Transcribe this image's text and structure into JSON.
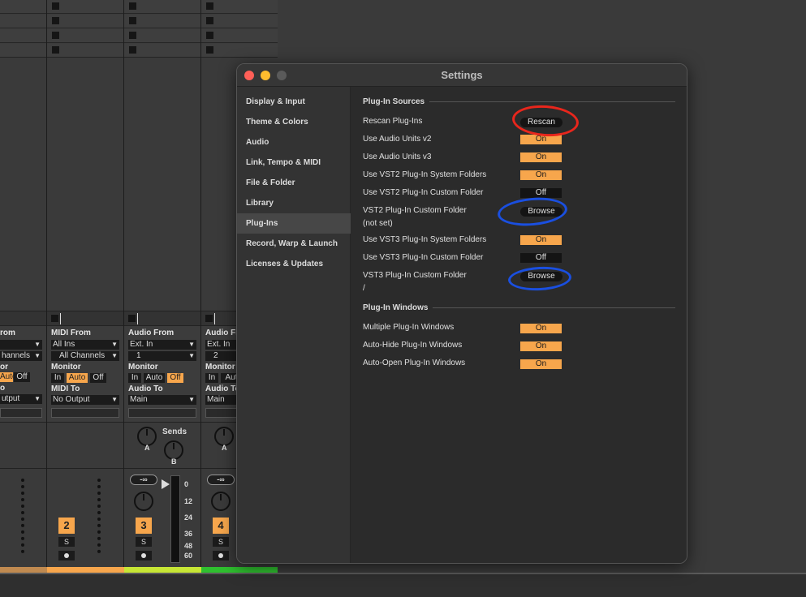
{
  "mixer": {
    "tracks": [
      {
        "from_label": "rom",
        "from_value": "",
        "ch_value": "hannels",
        "monitor_label": "or",
        "monitor_buttons": [
          "Auto",
          "Off"
        ],
        "to_label": "o",
        "to_value": "utput",
        "number": "",
        "solo": ""
      },
      {
        "from_label": "MIDI From",
        "from_value": "All Ins",
        "ch_value": "All Channels",
        "monitor_label": "Monitor",
        "monitor_buttons": [
          "In",
          "Auto",
          "Off"
        ],
        "to_label": "MIDI To",
        "to_value": "No Output",
        "number": "2",
        "solo": "S"
      },
      {
        "from_label": "Audio From",
        "from_value": "Ext. In",
        "ch_value": "1",
        "monitor_label": "Monitor",
        "monitor_buttons": [
          "In",
          "Auto",
          "Off"
        ],
        "to_label": "Audio To",
        "to_value": "Main",
        "number": "3",
        "solo": "S",
        "volume": "-∞",
        "sends_label": "Sends",
        "send_a": "A",
        "send_b": "B",
        "meter_scale": [
          "0",
          "12",
          "24",
          "36",
          "48",
          "60"
        ]
      },
      {
        "from_label": "Audio Fr",
        "from_value": "Ext. In",
        "ch_value": "2",
        "monitor_label": "Monitor",
        "monitor_buttons": [
          "In",
          "Aut"
        ],
        "to_label": "Audio To",
        "to_value": "Main",
        "number": "4",
        "solo": "S",
        "volume": "-∞",
        "send_a": "A"
      }
    ]
  },
  "settings": {
    "title": "Settings",
    "sidebar": [
      "Display & Input",
      "Theme & Colors",
      "Audio",
      "Link, Tempo & MIDI",
      "File & Folder",
      "Library",
      "Plug-Ins",
      "Record, Warp & Launch",
      "Licenses & Updates"
    ],
    "selected_index": 6,
    "sources_heading": "Plug-In Sources",
    "rows": [
      {
        "label": "Rescan Plug-Ins",
        "control": "Rescan",
        "kind": "pill"
      },
      {
        "label": "Use Audio Units v2",
        "control": "On",
        "kind": "on"
      },
      {
        "label": "Use Audio Units v3",
        "control": "On",
        "kind": "on"
      },
      {
        "label": "Use VST2 Plug-In System Folders",
        "control": "On",
        "kind": "on"
      },
      {
        "label": "Use VST2 Plug-In Custom Folder",
        "control": "Off",
        "kind": "off"
      },
      {
        "label": "VST2 Plug-In Custom Folder",
        "sub": "(not set)",
        "control": "Browse",
        "kind": "pill"
      },
      {
        "label": "Use VST3 Plug-In System Folders",
        "control": "On",
        "kind": "on"
      },
      {
        "label": "Use VST3 Plug-In Custom Folder",
        "control": "Off",
        "kind": "off"
      },
      {
        "label": "VST3 Plug-In Custom Folder",
        "sub": "/",
        "control": "Browse",
        "kind": "pill"
      }
    ],
    "windows_heading": "Plug-In Windows",
    "window_rows": [
      {
        "label": "Multiple Plug-In Windows",
        "control": "On"
      },
      {
        "label": "Auto-Hide Plug-In Windows",
        "control": "On"
      },
      {
        "label": "Auto-Open Plug-In Windows",
        "control": "On"
      }
    ]
  },
  "colors": {
    "accent": "#f7a64c",
    "annotation_red": "#e8261c",
    "annotation_blue": "#1a4fe0"
  }
}
